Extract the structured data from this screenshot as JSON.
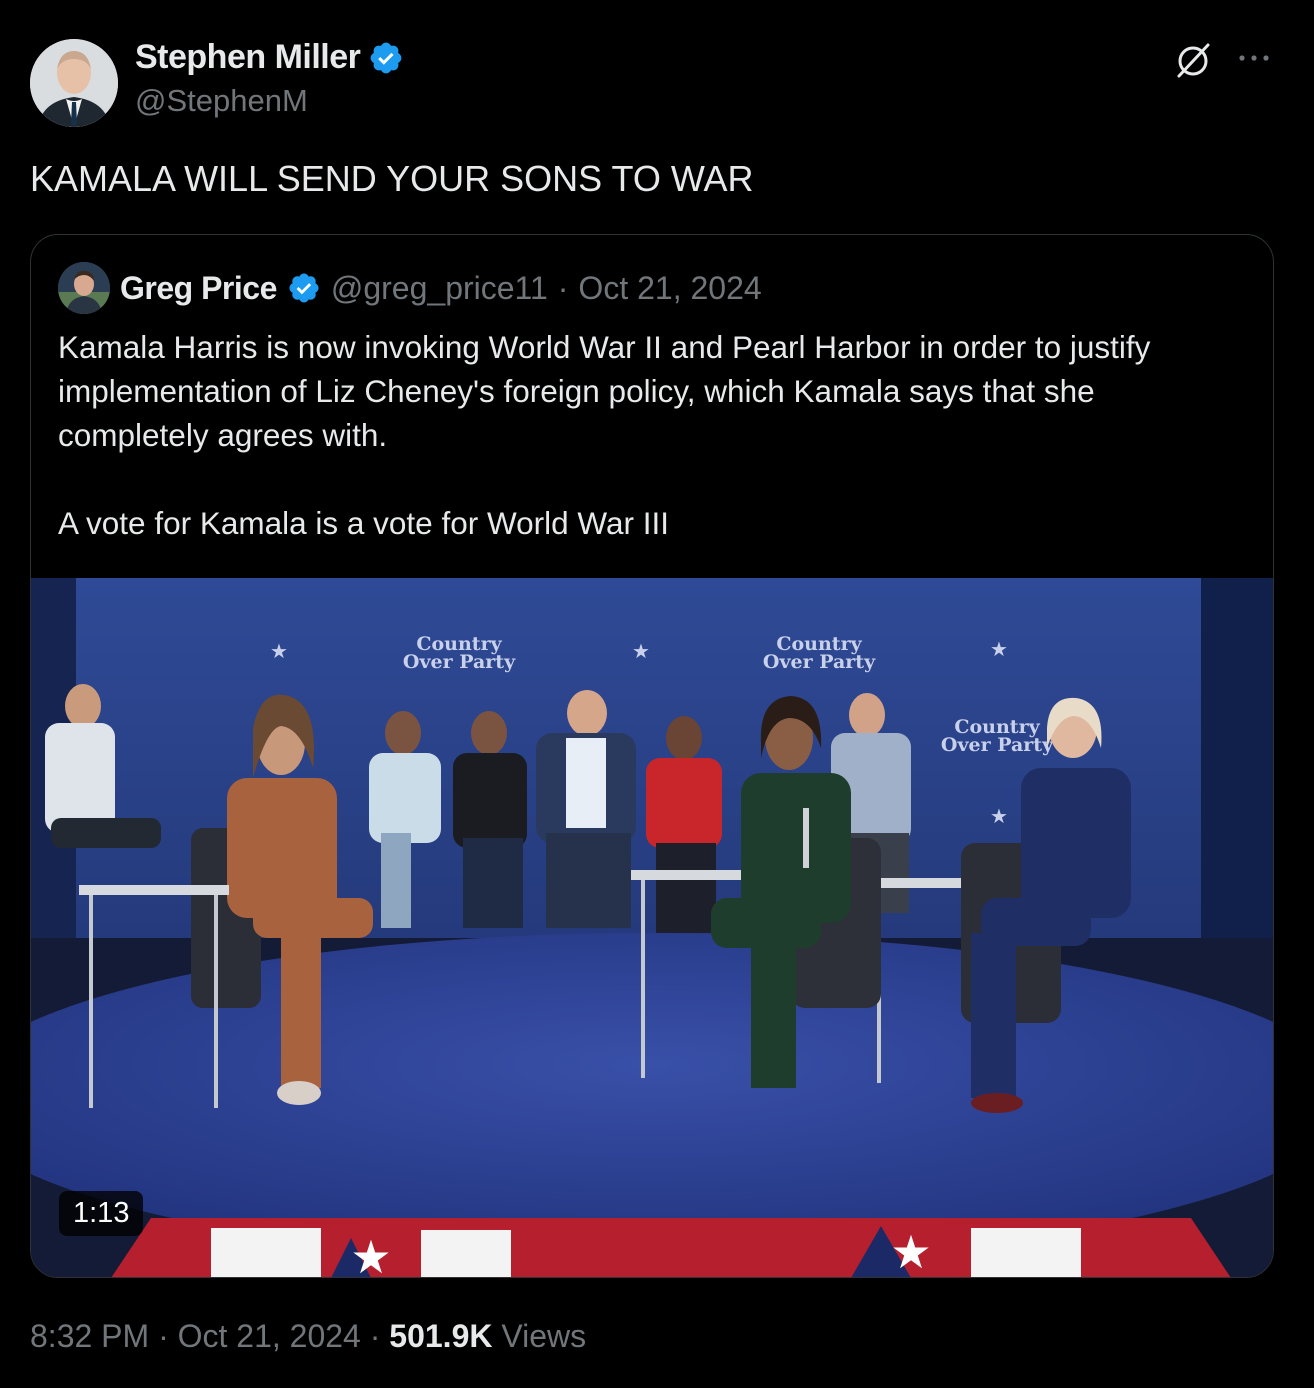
{
  "tweet": {
    "author": {
      "name": "Stephen Miller",
      "handle": "@StephenM",
      "verified": true
    },
    "text": "KAMALA WILL SEND YOUR SONS TO WAR",
    "quoted": {
      "author": {
        "name": "Greg Price",
        "handle": "@greg_price11",
        "verified": true
      },
      "separator": "·",
      "date": "Oct 21, 2024",
      "paragraphs": [
        "Kamala Harris is now invoking World War II and Pearl Harbor in order to justify implementation of Liz Cheney's foreign policy, which Kamala says that she completely agrees with.",
        "A vote for Kamala is a vote for World War III"
      ],
      "video": {
        "duration": "1:13",
        "backdrop_texts": [
          "Country",
          "Over Party"
        ]
      }
    },
    "footer": {
      "time": "8:32 PM",
      "separator": "·",
      "date": "Oct 21, 2024",
      "views_count": "501.9K",
      "views_label": "Views"
    }
  },
  "colors": {
    "background": "#000000",
    "primary_text": "#e7e9ea",
    "secondary_text": "#71767b",
    "verified_blue": "#1d9bf0",
    "border": "#2f3336"
  },
  "icons": [
    "verified-badge-icon",
    "grok-icon",
    "more-icon"
  ]
}
